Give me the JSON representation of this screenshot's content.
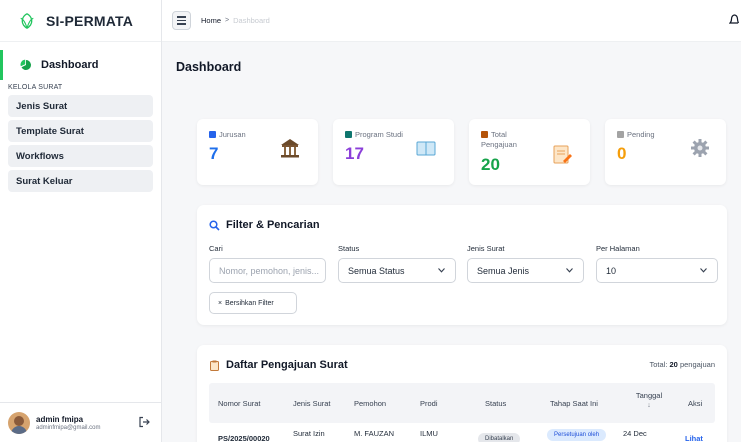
{
  "app": {
    "brand": "SI-PERMATA"
  },
  "sidebar": {
    "active_item": "Dashboard",
    "section_label": "KELOLA SURAT",
    "items": [
      {
        "label": "Jenis Surat"
      },
      {
        "label": "Template Surat"
      },
      {
        "label": "Workflows"
      },
      {
        "label": "Surat Keluar"
      }
    ],
    "user": {
      "name": "admin fmipa",
      "email": "adminfmipa@gmail.com"
    }
  },
  "breadcrumb": {
    "home": "Home",
    "separator": ">",
    "current": "Dashboard"
  },
  "page": {
    "title": "Dashboard"
  },
  "stats": [
    {
      "label": "Jurusan",
      "value": "7",
      "icon": "bank-icon",
      "color": "#1f6feb"
    },
    {
      "label": "Program Studi",
      "value": "17",
      "icon": "book-icon",
      "color": "#8b3fd9"
    },
    {
      "label": "Total Pengajuan",
      "value": "20",
      "icon": "document-icon",
      "color": "#16a34a"
    },
    {
      "label": "Pending",
      "value": "0",
      "icon": "gear-icon",
      "color": "#f59e0b"
    }
  ],
  "filter": {
    "title": "Filter & Pencarian",
    "search_label": "Cari",
    "search_placeholder": "Nomor, pemohon, jenis...",
    "status_label": "Status",
    "status_value": "Semua Status",
    "jenis_label": "Jenis Surat",
    "jenis_value": "Semua Jenis",
    "per_page_label": "Per Halaman",
    "per_page_value": "10",
    "clear_label": "Bersihkan Filter"
  },
  "table": {
    "title": "Daftar Pengajuan Surat",
    "total_prefix": "Total:",
    "total_count": "20",
    "total_suffix": "pengajuan",
    "columns": [
      "Nomor Surat",
      "Jenis Surat",
      "Pemohon",
      "Prodi",
      "Status",
      "Tahap Saat Ini",
      "Tanggal",
      "Aksi"
    ],
    "sort_indicator": "↓",
    "rows": [
      {
        "nomor": "PS/2025/00020",
        "jenis": "Surat Izin",
        "pemohon": "M. FAUZAN",
        "prodi": "ILMU",
        "status": "Dibatalkan",
        "tahap": "Persetujuan oleh",
        "tanggal": "24 Dec",
        "aksi": "Lihat"
      }
    ]
  }
}
